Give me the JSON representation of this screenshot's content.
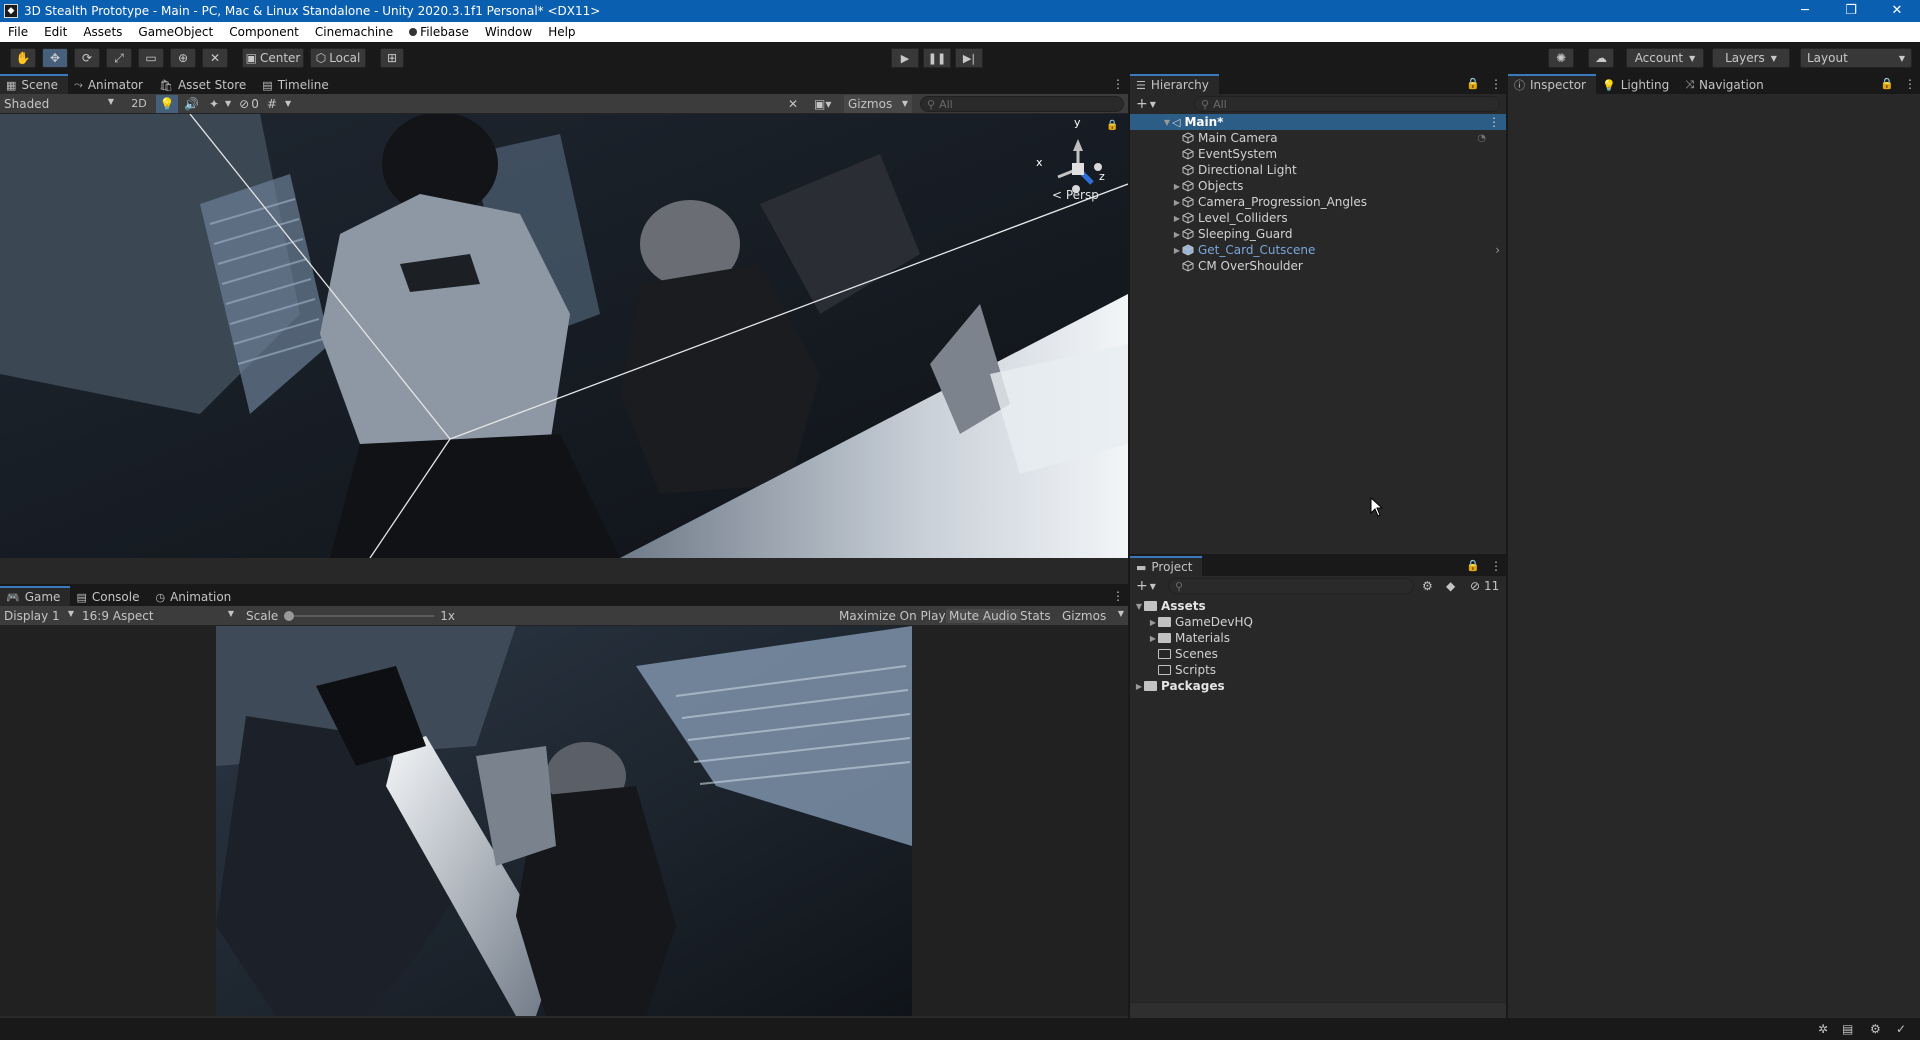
{
  "window": {
    "title": "3D Stealth Prototype - Main - PC, Mac & Linux Standalone - Unity 2020.3.1f1 Personal* <DX11>",
    "minimize": "─",
    "restore": "❐",
    "close": "✕"
  },
  "menu": [
    "File",
    "Edit",
    "Assets",
    "GameObject",
    "Component",
    "Cinemachine",
    "Filebase",
    "Window",
    "Help"
  ],
  "toolbar": {
    "pivot_label": "Center",
    "space_label": "Local",
    "account_label": "Account",
    "layers_label": "Layers",
    "layout_label": "Layout"
  },
  "scene_panel": {
    "tabs": [
      "Scene",
      "Animator",
      "Asset Store",
      "Timeline"
    ],
    "shading_mode": "Shaded",
    "mode_2d": "2D",
    "hidden_count": "0",
    "gizmos_label": "Gizmos",
    "search_placeholder": "All",
    "projection_label": "< Persp",
    "axis_x": "x",
    "axis_y": "y",
    "axis_z": "z"
  },
  "game_panel": {
    "tabs": [
      "Game",
      "Console",
      "Animation"
    ],
    "display": "Display 1",
    "aspect": "16:9 Aspect",
    "scale_label": "Scale",
    "scale_value": "1x",
    "maximize_on_play": "Maximize On Play",
    "mute_audio": "Mute Audio",
    "stats": "Stats",
    "gizmos_label": "Gizmos"
  },
  "hierarchy": {
    "tab": "Hierarchy",
    "search_placeholder": "All",
    "scene_name": "Main*",
    "items": [
      {
        "label": "Main Camera",
        "expandable": false,
        "prefab": false
      },
      {
        "label": "EventSystem",
        "expandable": false,
        "prefab": false
      },
      {
        "label": "Directional Light",
        "expandable": false,
        "prefab": false
      },
      {
        "label": "Objects",
        "expandable": true,
        "prefab": false
      },
      {
        "label": "Camera_Progression_Angles",
        "expandable": true,
        "prefab": false
      },
      {
        "label": "Level_Colliders",
        "expandable": true,
        "prefab": false
      },
      {
        "label": "Sleeping_Guard",
        "expandable": true,
        "prefab": false
      },
      {
        "label": "Get_Card_Cutscene",
        "expandable": true,
        "prefab": true
      },
      {
        "label": "CM OverShoulder",
        "expandable": false,
        "prefab": false
      }
    ]
  },
  "inspector_panel": {
    "tabs": [
      "Inspector",
      "Lighting",
      "Navigation"
    ]
  },
  "project": {
    "tab": "Project",
    "hidden_packages_count": "11",
    "tree": [
      {
        "label": "Assets",
        "level": 0,
        "expandable": true,
        "bold": true
      },
      {
        "label": "GameDevHQ",
        "level": 1,
        "expandable": true,
        "bold": false
      },
      {
        "label": "Materials",
        "level": 1,
        "expandable": true,
        "bold": false
      },
      {
        "label": "Scenes",
        "level": 1,
        "expandable": false,
        "bold": false
      },
      {
        "label": "Scripts",
        "level": 1,
        "expandable": false,
        "bold": false
      },
      {
        "label": "Packages",
        "level": 0,
        "expandable": true,
        "bold": true
      }
    ]
  },
  "colors": {
    "titlebar": "#0b5fb0",
    "active_tab_accent": "#3a79bb",
    "panel_bg": "#282828",
    "selected_row": "#2c5d87"
  }
}
